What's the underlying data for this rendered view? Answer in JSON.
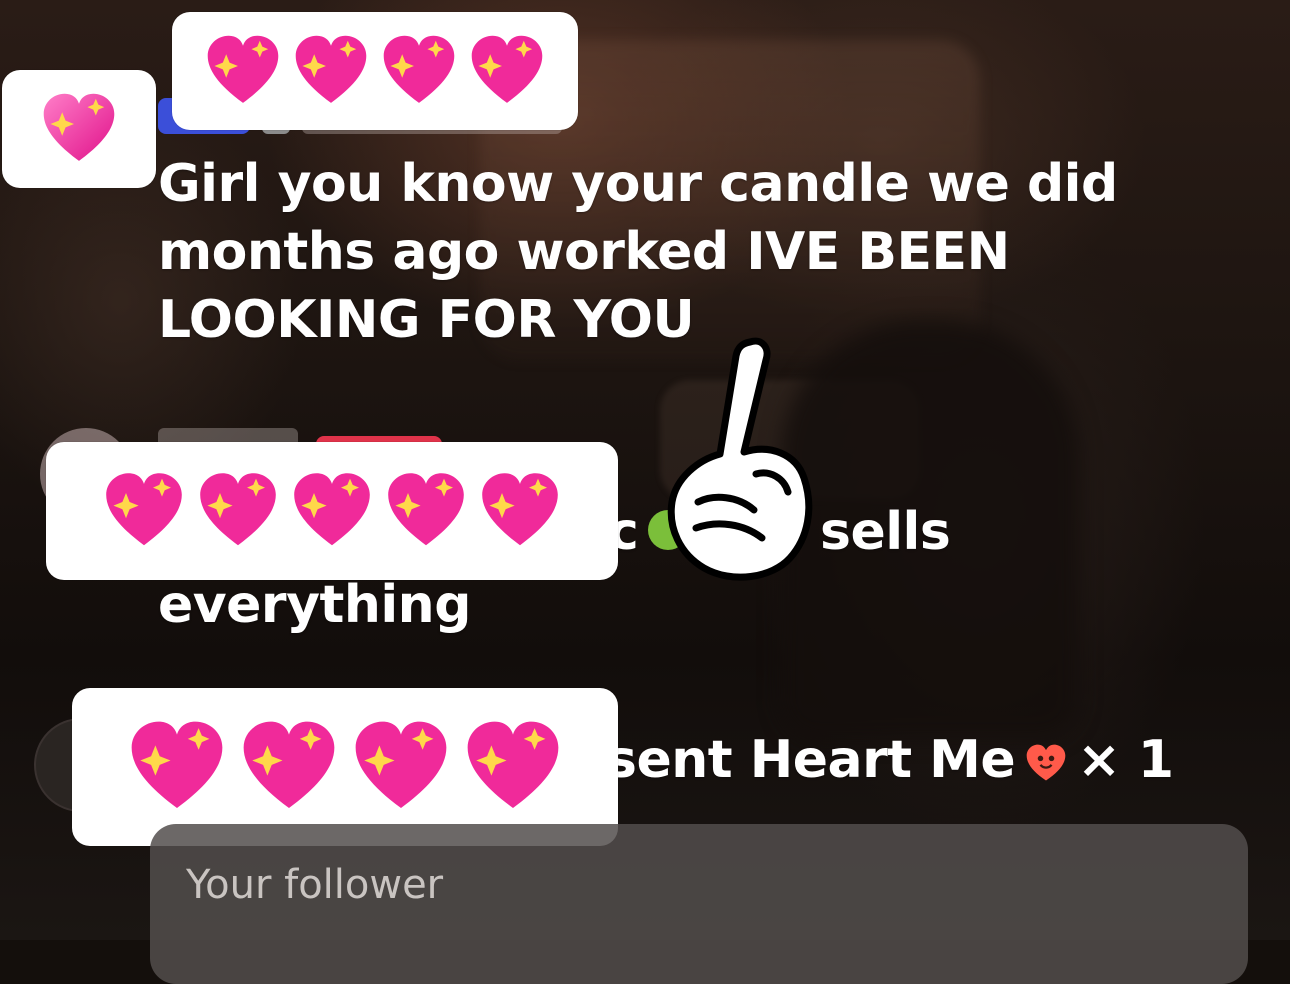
{
  "messages": [
    {
      "text": "Girl you know your candle we did months ago worked IVE BEEN LOOKING FOR YOU"
    },
    {
      "partial_before": "c",
      "text_tail": "sells",
      "text_line2": "everything"
    },
    {
      "gift_text": "sent Heart Me",
      "gift_count": "× 1"
    }
  ],
  "input": {
    "placeholder": "Your follower"
  },
  "icons": {
    "redaction": "sparkling-heart-icon",
    "gesture": "pointing-hand-icon",
    "emoji": "frog-icon",
    "gift": "heart-me-gift-icon"
  },
  "colors": {
    "heart": "#ff2fa0",
    "badge_blue": "#3b4fd9",
    "badge_red": "#e0334a"
  }
}
